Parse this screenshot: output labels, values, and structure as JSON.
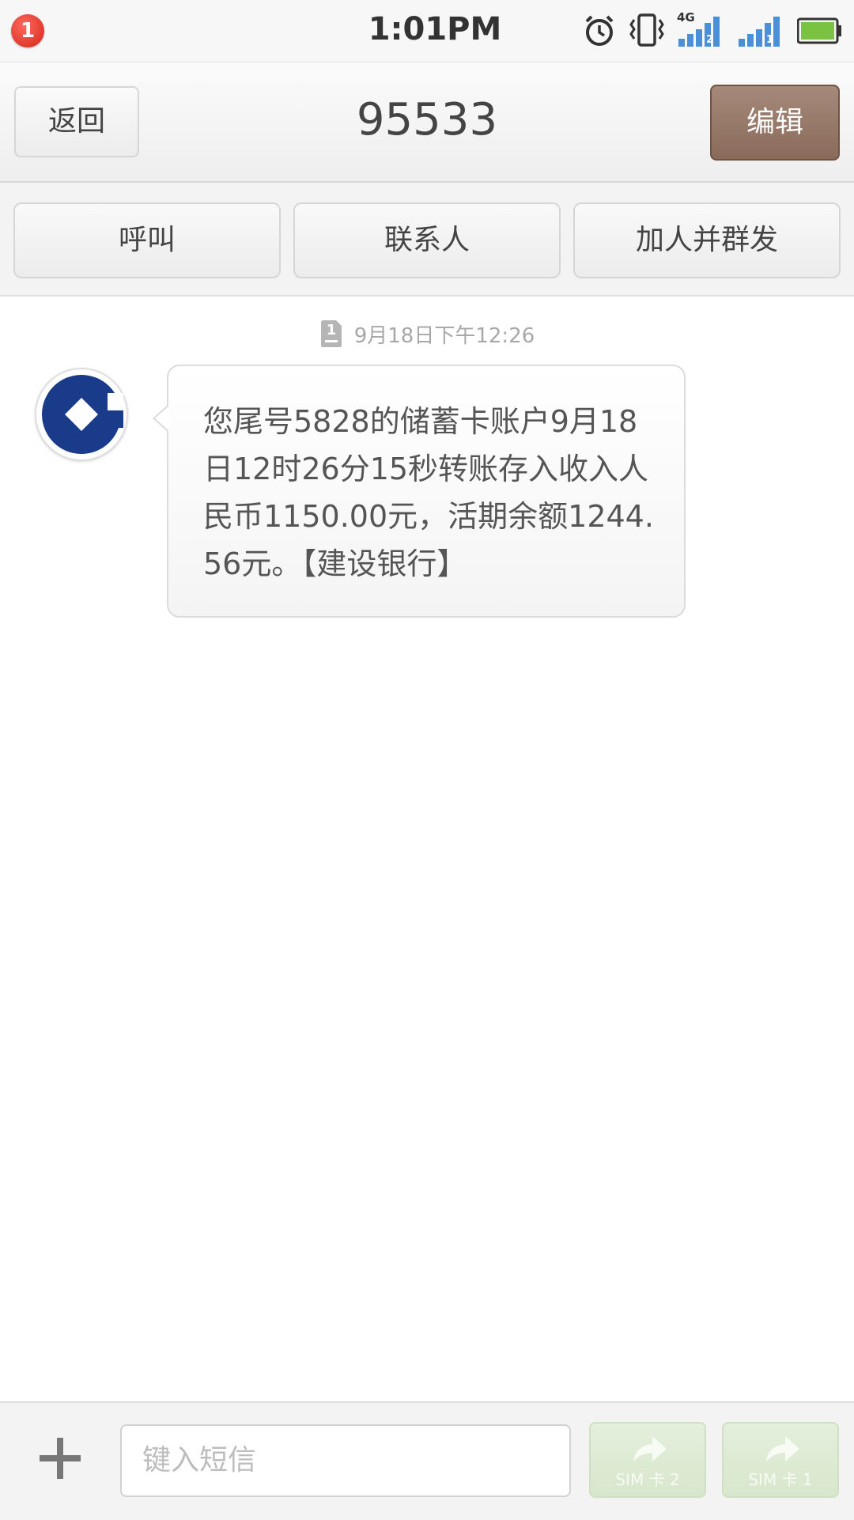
{
  "status_bar": {
    "notification_count": "1",
    "time": "1:01PM",
    "network_label": "4G",
    "sim2_label": "2",
    "sim1_label": "1",
    "icons": [
      "alarm-icon",
      "vibrate-icon",
      "signal-sim2-icon",
      "signal-sim1-icon",
      "battery-icon"
    ]
  },
  "header": {
    "back_label": "返回",
    "title": "95533",
    "edit_label": "编辑"
  },
  "actions": {
    "call_label": "呼叫",
    "contact_label": "联系人",
    "group_send_label": "加人并群发"
  },
  "conversation": {
    "date": "9月18日下午12:26",
    "sim_badge": "1",
    "message": "您尾号5828的储蓄卡账户9月18日12时26分15秒转账存入收入人民币1150.00元，活期余额1244.56元。【建设银行】",
    "avatar": "ccb-logo"
  },
  "composer": {
    "placeholder": "键入短信",
    "send_sim2_label": "SIM 卡 2",
    "send_sim1_label": "SIM 卡 1"
  },
  "colors": {
    "edit_button": "#8a6b5a",
    "send_button": "#d7e7cc",
    "signal": "#4a90d9",
    "battery": "#7cc242",
    "ccb_blue": "#1a3a8a"
  }
}
